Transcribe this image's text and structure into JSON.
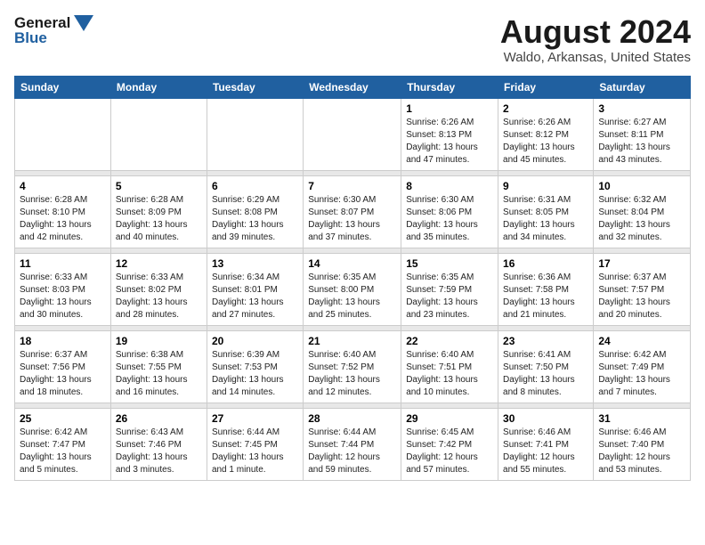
{
  "header": {
    "logo_line1": "General",
    "logo_line2": "Blue",
    "main_title": "August 2024",
    "subtitle": "Waldo, Arkansas, United States"
  },
  "days_of_week": [
    "Sunday",
    "Monday",
    "Tuesday",
    "Wednesday",
    "Thursday",
    "Friday",
    "Saturday"
  ],
  "weeks": [
    {
      "days": [
        {
          "num": "",
          "info": ""
        },
        {
          "num": "",
          "info": ""
        },
        {
          "num": "",
          "info": ""
        },
        {
          "num": "",
          "info": ""
        },
        {
          "num": "1",
          "info": "Sunrise: 6:26 AM\nSunset: 8:13 PM\nDaylight: 13 hours\nand 47 minutes."
        },
        {
          "num": "2",
          "info": "Sunrise: 6:26 AM\nSunset: 8:12 PM\nDaylight: 13 hours\nand 45 minutes."
        },
        {
          "num": "3",
          "info": "Sunrise: 6:27 AM\nSunset: 8:11 PM\nDaylight: 13 hours\nand 43 minutes."
        }
      ]
    },
    {
      "days": [
        {
          "num": "4",
          "info": "Sunrise: 6:28 AM\nSunset: 8:10 PM\nDaylight: 13 hours\nand 42 minutes."
        },
        {
          "num": "5",
          "info": "Sunrise: 6:28 AM\nSunset: 8:09 PM\nDaylight: 13 hours\nand 40 minutes."
        },
        {
          "num": "6",
          "info": "Sunrise: 6:29 AM\nSunset: 8:08 PM\nDaylight: 13 hours\nand 39 minutes."
        },
        {
          "num": "7",
          "info": "Sunrise: 6:30 AM\nSunset: 8:07 PM\nDaylight: 13 hours\nand 37 minutes."
        },
        {
          "num": "8",
          "info": "Sunrise: 6:30 AM\nSunset: 8:06 PM\nDaylight: 13 hours\nand 35 minutes."
        },
        {
          "num": "9",
          "info": "Sunrise: 6:31 AM\nSunset: 8:05 PM\nDaylight: 13 hours\nand 34 minutes."
        },
        {
          "num": "10",
          "info": "Sunrise: 6:32 AM\nSunset: 8:04 PM\nDaylight: 13 hours\nand 32 minutes."
        }
      ]
    },
    {
      "days": [
        {
          "num": "11",
          "info": "Sunrise: 6:33 AM\nSunset: 8:03 PM\nDaylight: 13 hours\nand 30 minutes."
        },
        {
          "num": "12",
          "info": "Sunrise: 6:33 AM\nSunset: 8:02 PM\nDaylight: 13 hours\nand 28 minutes."
        },
        {
          "num": "13",
          "info": "Sunrise: 6:34 AM\nSunset: 8:01 PM\nDaylight: 13 hours\nand 27 minutes."
        },
        {
          "num": "14",
          "info": "Sunrise: 6:35 AM\nSunset: 8:00 PM\nDaylight: 13 hours\nand 25 minutes."
        },
        {
          "num": "15",
          "info": "Sunrise: 6:35 AM\nSunset: 7:59 PM\nDaylight: 13 hours\nand 23 minutes."
        },
        {
          "num": "16",
          "info": "Sunrise: 6:36 AM\nSunset: 7:58 PM\nDaylight: 13 hours\nand 21 minutes."
        },
        {
          "num": "17",
          "info": "Sunrise: 6:37 AM\nSunset: 7:57 PM\nDaylight: 13 hours\nand 20 minutes."
        }
      ]
    },
    {
      "days": [
        {
          "num": "18",
          "info": "Sunrise: 6:37 AM\nSunset: 7:56 PM\nDaylight: 13 hours\nand 18 minutes."
        },
        {
          "num": "19",
          "info": "Sunrise: 6:38 AM\nSunset: 7:55 PM\nDaylight: 13 hours\nand 16 minutes."
        },
        {
          "num": "20",
          "info": "Sunrise: 6:39 AM\nSunset: 7:53 PM\nDaylight: 13 hours\nand 14 minutes."
        },
        {
          "num": "21",
          "info": "Sunrise: 6:40 AM\nSunset: 7:52 PM\nDaylight: 13 hours\nand 12 minutes."
        },
        {
          "num": "22",
          "info": "Sunrise: 6:40 AM\nSunset: 7:51 PM\nDaylight: 13 hours\nand 10 minutes."
        },
        {
          "num": "23",
          "info": "Sunrise: 6:41 AM\nSunset: 7:50 PM\nDaylight: 13 hours\nand 8 minutes."
        },
        {
          "num": "24",
          "info": "Sunrise: 6:42 AM\nSunset: 7:49 PM\nDaylight: 13 hours\nand 7 minutes."
        }
      ]
    },
    {
      "days": [
        {
          "num": "25",
          "info": "Sunrise: 6:42 AM\nSunset: 7:47 PM\nDaylight: 13 hours\nand 5 minutes."
        },
        {
          "num": "26",
          "info": "Sunrise: 6:43 AM\nSunset: 7:46 PM\nDaylight: 13 hours\nand 3 minutes."
        },
        {
          "num": "27",
          "info": "Sunrise: 6:44 AM\nSunset: 7:45 PM\nDaylight: 13 hours\nand 1 minute."
        },
        {
          "num": "28",
          "info": "Sunrise: 6:44 AM\nSunset: 7:44 PM\nDaylight: 12 hours\nand 59 minutes."
        },
        {
          "num": "29",
          "info": "Sunrise: 6:45 AM\nSunset: 7:42 PM\nDaylight: 12 hours\nand 57 minutes."
        },
        {
          "num": "30",
          "info": "Sunrise: 6:46 AM\nSunset: 7:41 PM\nDaylight: 12 hours\nand 55 minutes."
        },
        {
          "num": "31",
          "info": "Sunrise: 6:46 AM\nSunset: 7:40 PM\nDaylight: 12 hours\nand 53 minutes."
        }
      ]
    }
  ]
}
